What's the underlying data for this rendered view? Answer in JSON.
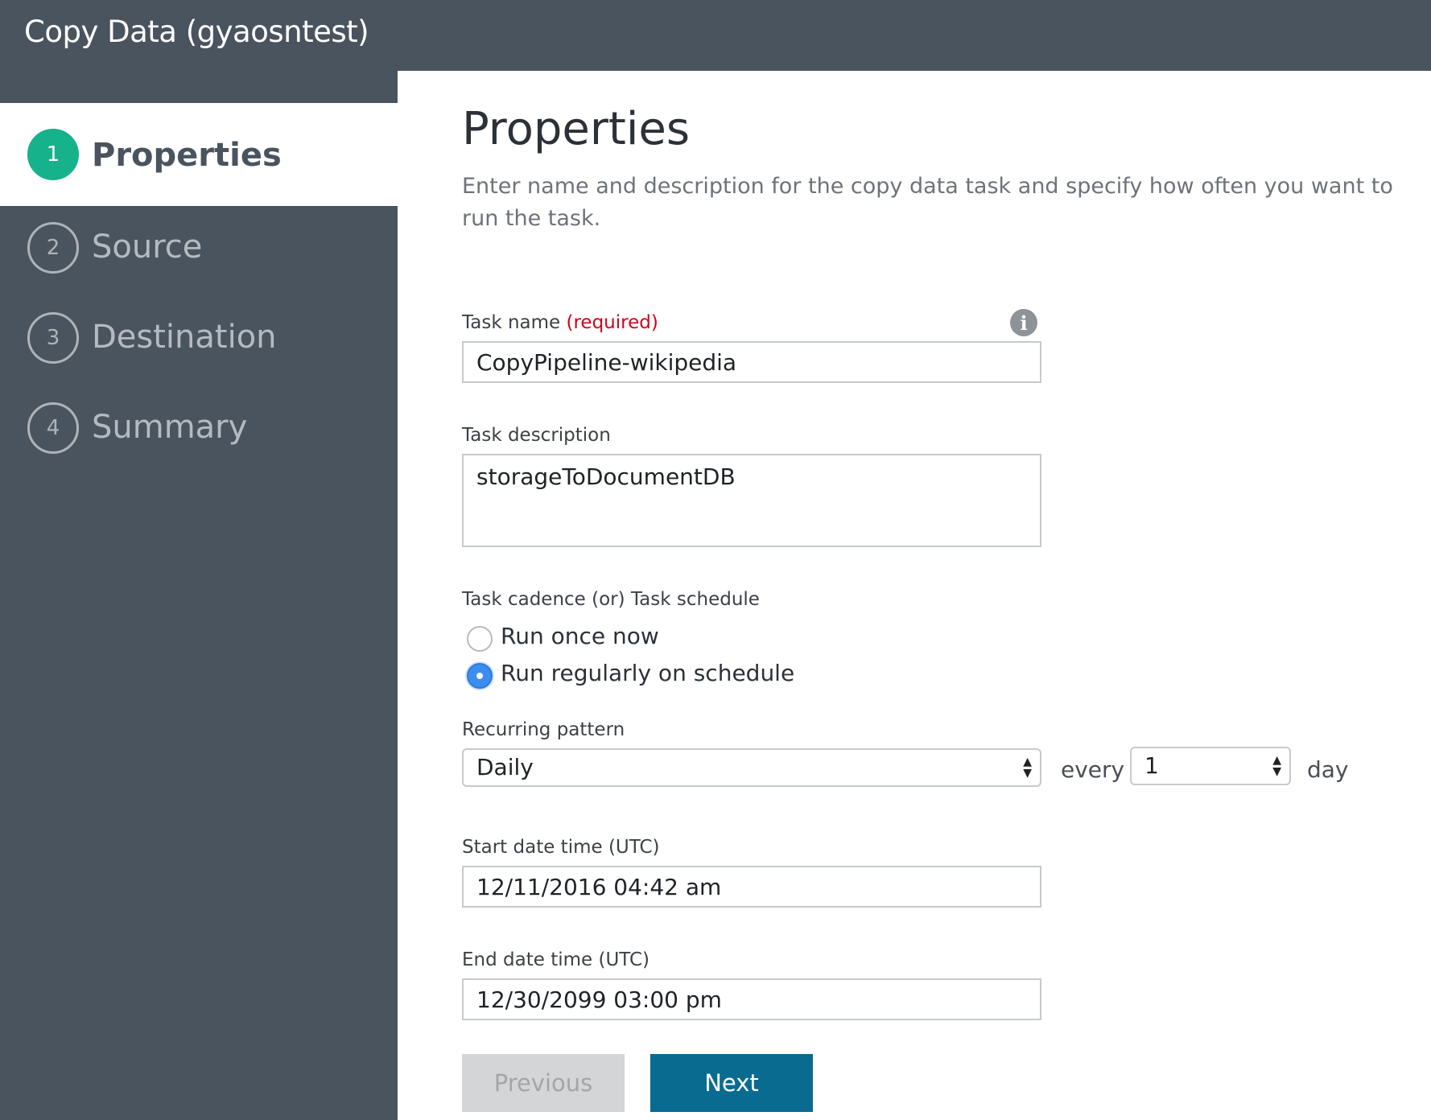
{
  "window": {
    "title": "Copy Data (gyaosntest)"
  },
  "steps": [
    {
      "number": "1",
      "label": "Properties",
      "active": true
    },
    {
      "number": "2",
      "label": "Source",
      "active": false
    },
    {
      "number": "3",
      "label": "Destination",
      "active": false
    },
    {
      "number": "4",
      "label": "Summary",
      "active": false
    }
  ],
  "main": {
    "title": "Properties",
    "description": "Enter name and description for the copy data task and specify how often you want to run the task."
  },
  "form": {
    "task_name": {
      "label": "Task name",
      "required_text": "(required)",
      "value": "CopyPipeline-wikipedia"
    },
    "task_description": {
      "label": "Task description",
      "value": "storageToDocumentDB"
    },
    "cadence": {
      "label": "Task cadence (or) Task schedule",
      "options": [
        {
          "label": "Run once now",
          "checked": false
        },
        {
          "label": "Run regularly on schedule",
          "checked": true
        }
      ]
    },
    "recurring": {
      "label": "Recurring pattern",
      "pattern_value": "Daily",
      "every_text": "every",
      "interval_value": "1",
      "unit_text": "day"
    },
    "start": {
      "label": "Start date time (UTC)",
      "value": "12/11/2016 04:42 am"
    },
    "end": {
      "label": "End date time (UTC)",
      "value": "12/30/2099 03:00 pm"
    }
  },
  "buttons": {
    "previous": "Previous",
    "next": "Next"
  },
  "colors": {
    "sidebar_bg": "#4a545f",
    "accent_green": "#16b28c",
    "primary_button": "#0a6b91",
    "required_red": "#d0021b",
    "radio_blue": "#3b8df0"
  },
  "icons": {
    "info": "info-icon"
  }
}
